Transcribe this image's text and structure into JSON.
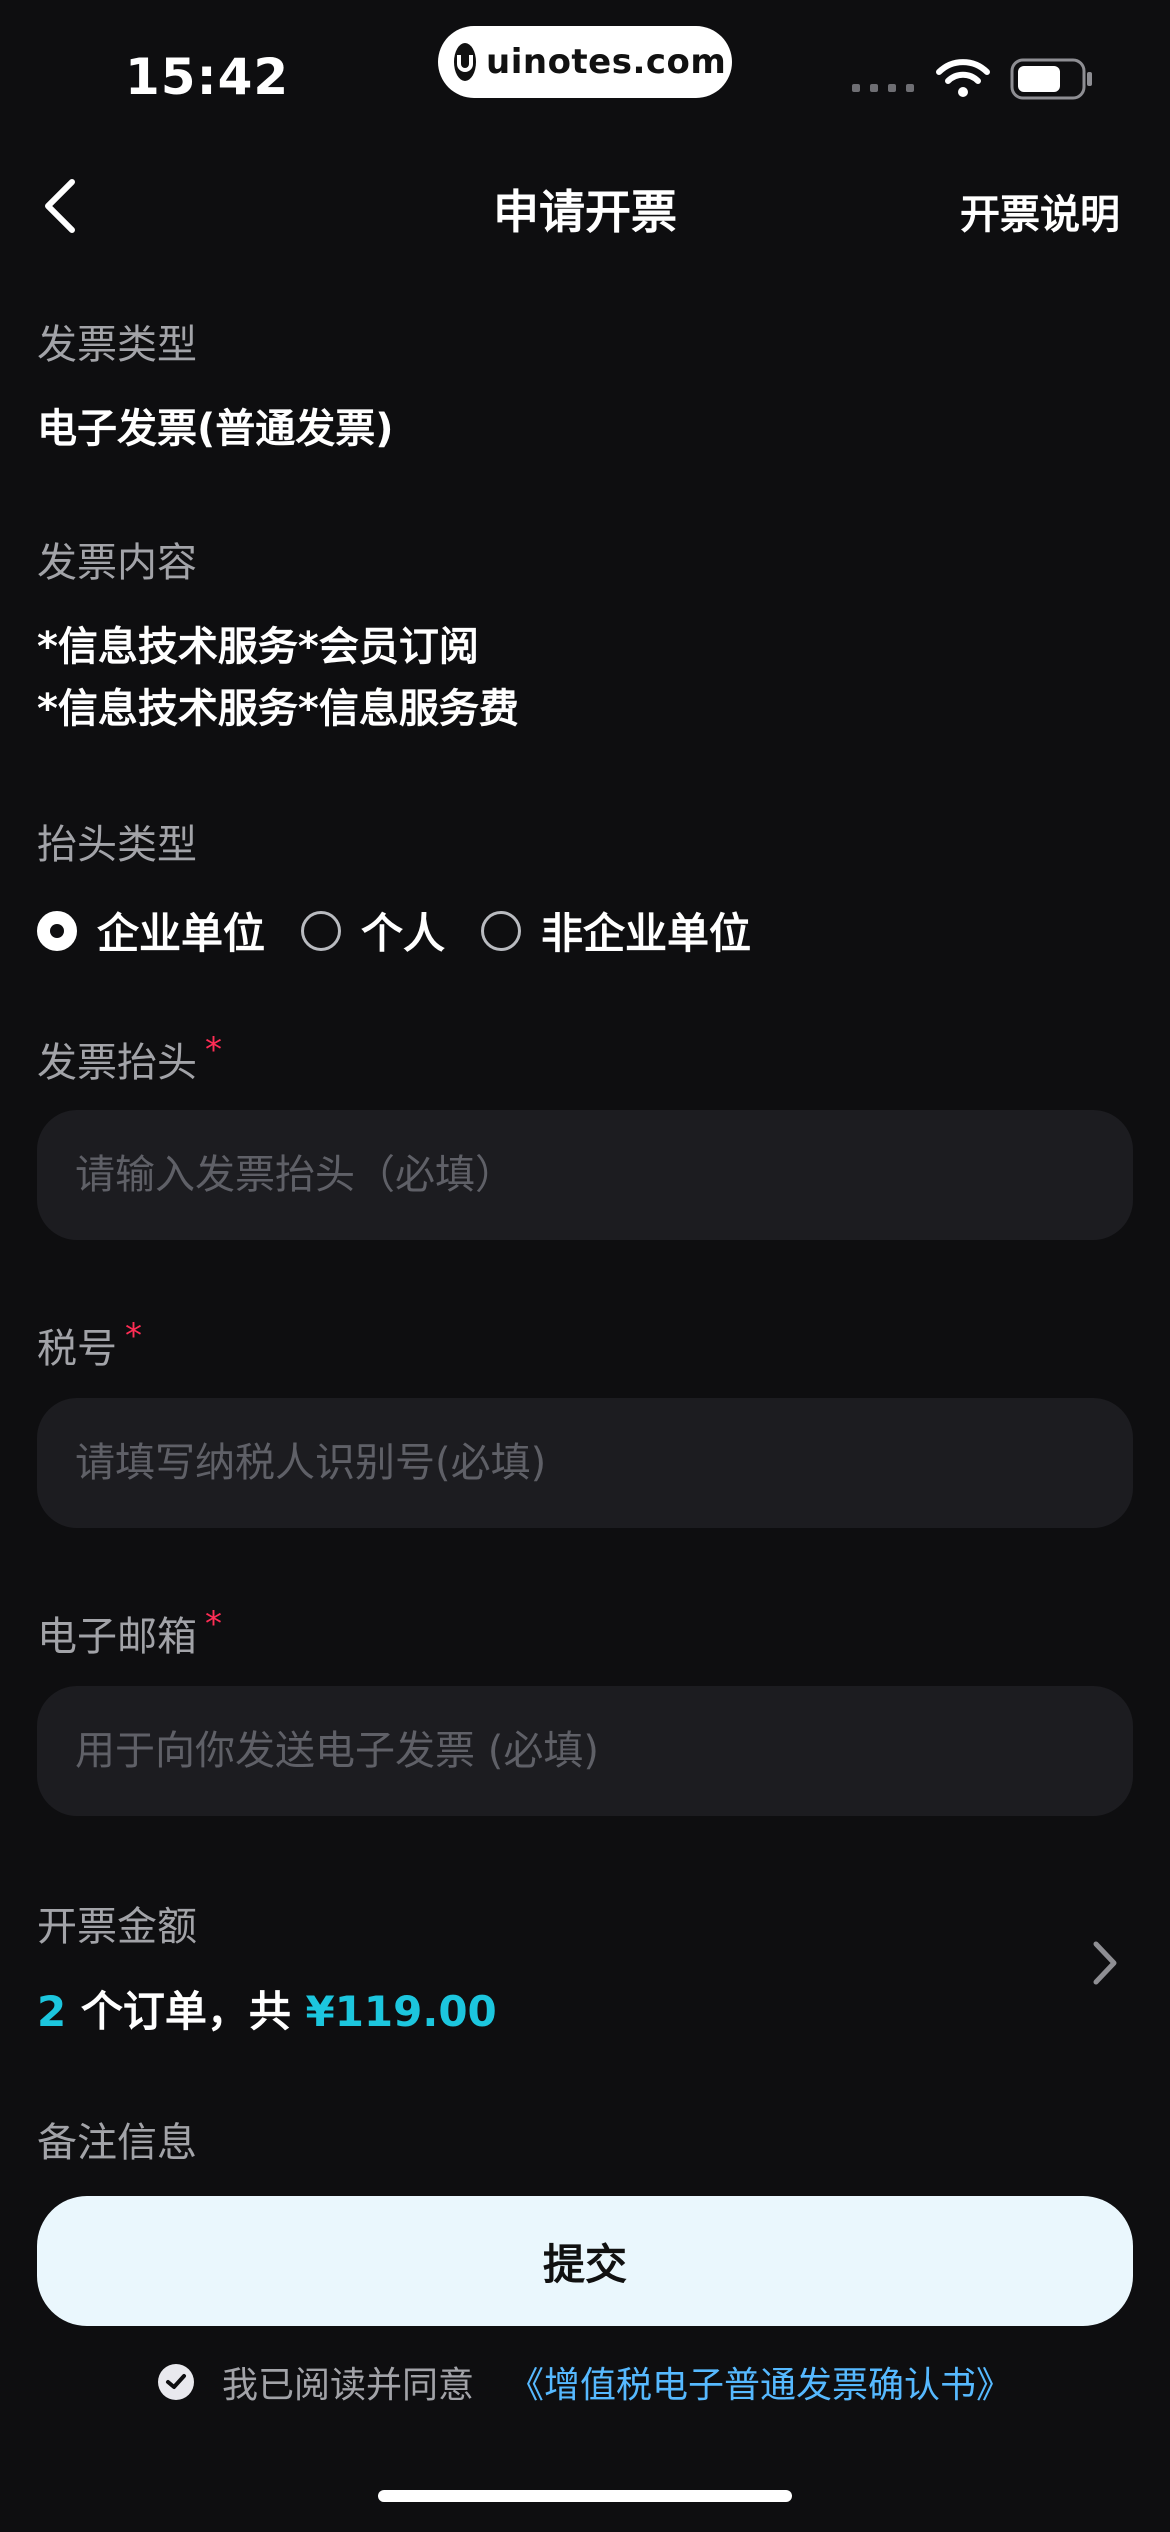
{
  "status_bar": {
    "time": "15:42",
    "url_pill": "uinotes.com"
  },
  "nav": {
    "title": "申请开票",
    "right_link": "开票说明"
  },
  "invoice_type": {
    "label": "发票类型",
    "value": "电子发票(普通发票)"
  },
  "invoice_content": {
    "label": "发票内容",
    "lines": [
      "*信息技术服务*会员订阅",
      "*信息技术服务*信息服务费"
    ]
  },
  "title_type": {
    "label": "抬头类型",
    "options": [
      {
        "label": "企业单位",
        "checked": true
      },
      {
        "label": "个人",
        "checked": false
      },
      {
        "label": "非企业单位",
        "checked": false
      }
    ]
  },
  "invoice_header": {
    "label": "发票抬头",
    "required_mark": "*",
    "placeholder": "请输入发票抬头（必填）",
    "value": ""
  },
  "tax_number": {
    "label": "税号",
    "required_mark": "*",
    "placeholder": "请填写纳税人识别号(必填)",
    "value": ""
  },
  "email": {
    "label": "电子邮箱",
    "required_mark": "*",
    "placeholder": "用于向你发送电子发票 (必填)",
    "value": ""
  },
  "amount": {
    "label": "开票金额",
    "order_count": "2",
    "middle_text": " 个订单，共 ",
    "total": "¥119.00"
  },
  "remark": {
    "label": "备注信息"
  },
  "submit": {
    "label": "提交"
  },
  "agreement": {
    "text": "我已阅读并同意",
    "link": "《增值税电子普通发票确认书》",
    "checked": true
  },
  "colors": {
    "background": "#0e0e10",
    "accent": "#1cc6de",
    "link": "#56b9ff",
    "required": "#ff2d55",
    "field_bg": "#1c1c20",
    "submit_bg": "#eaf7fd"
  }
}
